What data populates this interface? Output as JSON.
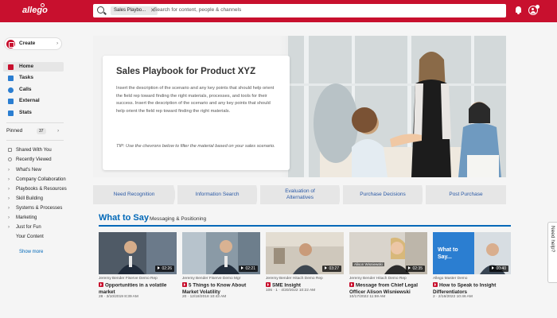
{
  "header": {
    "logo": "allego",
    "search_chip": "Sales Playbo...",
    "search_placeholder": "Search for content, people & channels"
  },
  "sidebar": {
    "create_label": "Create",
    "nav": [
      {
        "label": "Home",
        "icon": "home-icon",
        "active": true
      },
      {
        "label": "Tasks",
        "icon": "tasks-icon"
      },
      {
        "label": "Calls",
        "icon": "calls-icon"
      },
      {
        "label": "External",
        "icon": "external-icon"
      },
      {
        "label": "Stats",
        "icon": "stats-icon"
      }
    ],
    "pinned_label": "Pinned",
    "pinned_count": "37",
    "links": [
      {
        "label": "Shared With You",
        "icon": "shared-icon"
      },
      {
        "label": "Recently Viewed",
        "icon": "clock-icon"
      }
    ],
    "channels": [
      {
        "label": "What's New",
        "chevron": true
      },
      {
        "label": "Company Collaboration",
        "chevron": true
      },
      {
        "label": "Playbooks & Resources",
        "chevron": true
      },
      {
        "label": "Skill Building",
        "chevron": true
      },
      {
        "label": "Systems & Processes",
        "chevron": true
      },
      {
        "label": "Marketing",
        "chevron": true
      },
      {
        "label": "Just for Fun",
        "chevron": true
      },
      {
        "label": "Your Content",
        "chevron": false
      }
    ],
    "show_more": "Show more"
  },
  "hero": {
    "title": "Sales Playbook for Product XYZ",
    "description": "Insert the description of the scenario and any key points that should help orient the field rep toward finding the right materials, processes, and tools for their success.  Insert the description of the scenario and any key points that should help orient the field rep toward finding the right materials.",
    "tip": "TIP: Use the chevrons below to filter the material based on your sales scenario."
  },
  "stages": [
    "Need Recognition",
    "Information Search",
    "Evaluation of Alternatives",
    "Purchase Decisions",
    "Post Purchase"
  ],
  "section": {
    "title": "What to Say",
    "subtitle": "- Messaging & Positioning"
  },
  "cards": [
    {
      "author": "Jeremy Bender Fiserve Demo Rep",
      "duration": "02:26",
      "title": "Opportunities in a volatile market",
      "meta": "28 · 3/10/2019 8:39 AM"
    },
    {
      "author": "Jeremy Bender Fiserve Demo Mgr",
      "duration": "02:21",
      "title": "5 Things to Know About Market Volatility",
      "meta": "20 · 12/18/2018 10:43 AM"
    },
    {
      "author": "Jeremy Bender Hitach Demo Rep",
      "duration": "03:27",
      "title": "SME Insight",
      "meta": "106 · 1 · 4/20/2022 10:22 AM"
    },
    {
      "author": "Jeremy Bender Hitach Demo Rep",
      "duration": "02:35",
      "title": "Message from Chief Legal Officer Alison Wisniewski",
      "meta": "10/17/2022 11:59 AM"
    },
    {
      "author": "Allego Master Demo",
      "duration": "00:40",
      "title": "How to Speak to Insight Differentiators",
      "meta": "2 · 2/16/2022 10:46 AM"
    }
  ],
  "thumb_overlays": {
    "name_tag": "Alison Wisniewski",
    "what_to_say": "What to Say..."
  },
  "help": "Need help?",
  "colors": {
    "brand": "#c8102e",
    "accent": "#0068b8",
    "chevron_bg": "#e6e6e6"
  }
}
